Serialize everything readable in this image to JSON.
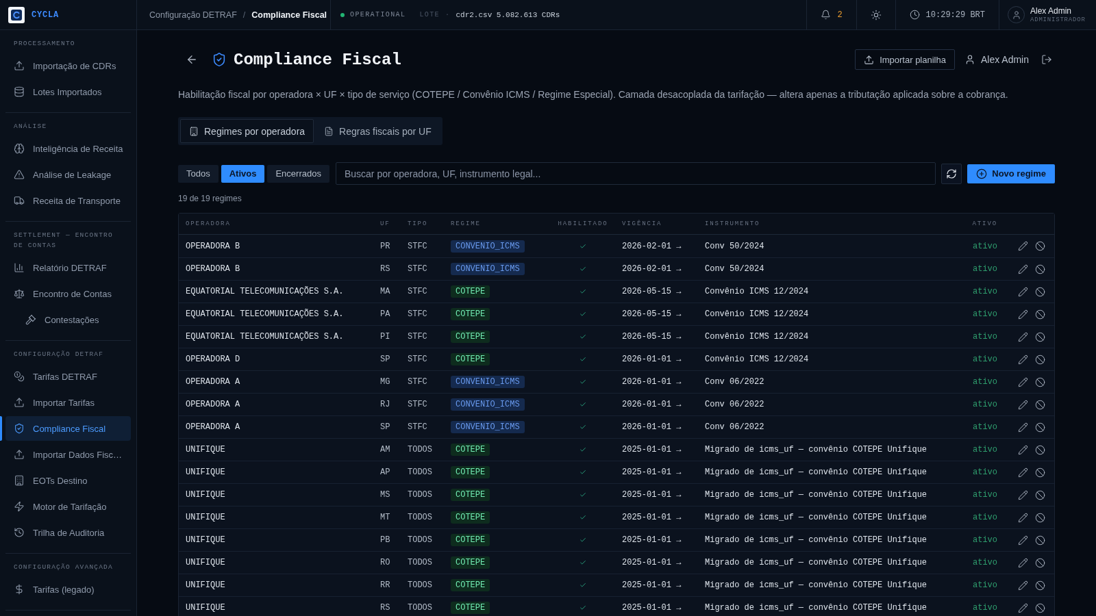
{
  "top_bar": {
    "brand": "CYCLA",
    "breadcrumb": {
      "parent": "Configuração DETRAF",
      "separator": "/",
      "current": "Compliance Fiscal"
    },
    "status": {
      "label": "OPERATIONAL",
      "online": true
    },
    "batch": {
      "label": "LOTE",
      "separator": "·",
      "file": "cdr2.csv 5.082.613 CDRs"
    },
    "notifications": {
      "count": "2"
    },
    "clock": "10:29:29 BRT",
    "user": {
      "name": "Alex Admin",
      "role": "ADMINISTRADOR"
    }
  },
  "sidebar": {
    "sections": [
      {
        "title": "PROCESSAMENTO",
        "items": [
          {
            "label": "Importação de CDRs",
            "selected": false
          },
          {
            "label": "Lotes Importados",
            "selected": false
          }
        ]
      },
      {
        "title": "ANÁLISE",
        "items": [
          {
            "label": "Inteligência de Receita",
            "selected": false
          },
          {
            "label": "Análise de Leakage",
            "selected": false
          },
          {
            "label": "Receita de Transporte",
            "selected": false
          }
        ]
      },
      {
        "title": "SETTLEMENT — ENCONTRO DE CONTAS",
        "items": [
          {
            "label": "Relatório DETRAF",
            "selected": false
          },
          {
            "label": "Encontro de Contas",
            "selected": false,
            "children": [
              {
                "label": "Contestações",
                "selected": false
              }
            ]
          }
        ]
      },
      {
        "title": "CONFIGURAÇÃO DETRAF",
        "items": [
          {
            "label": "Tarifas DETRAF",
            "selected": false
          },
          {
            "label": "Importar Tarifas",
            "selected": false
          },
          {
            "label": "Compliance Fiscal",
            "selected": true
          },
          {
            "label": "Importar Dados Fisc…",
            "selected": false
          },
          {
            "label": "EOTs Destino",
            "selected": false
          },
          {
            "label": "Motor de Tarifação",
            "selected": false
          },
          {
            "label": "Trilha de Auditoria",
            "selected": false
          }
        ]
      },
      {
        "title": "CONFIGURAÇÃO AVANÇADA",
        "items": [
          {
            "label": "Tarifas (legado)",
            "selected": false
          }
        ]
      }
    ]
  },
  "page": {
    "title": "Compliance Fiscal",
    "import_button": "Importar planilha",
    "user_name": "Alex Admin",
    "description": "Habilitação fiscal por operadora × UF × tipo de serviço (COTEPE / Convênio ICMS / Regime Especial). Camada desacoplada da tarifação — altera apenas a tributação aplicada sobre a cobrança.",
    "tabs": [
      {
        "label": "Regimes por operadora",
        "selected": true
      },
      {
        "label": "Regras fiscais por UF",
        "selected": false
      }
    ],
    "filters": [
      {
        "label": "Todos",
        "selected": false
      },
      {
        "label": "Ativos",
        "selected": true
      },
      {
        "label": "Encerrados",
        "selected": false
      }
    ],
    "search": {
      "placeholder": "Buscar por operadora, UF, instrumento legal..."
    },
    "new_button": "Novo regime",
    "count": "19 de 19 regimes",
    "table": {
      "columns": [
        "OPERADORA",
        "UF",
        "TIPO",
        "REGIME",
        "HABILITADO",
        "VIGÊNCIA",
        "INSTRUMENTO",
        "ATIVO"
      ],
      "rows": [
        {
          "operadora": "OPERADORA B",
          "uf": "PR",
          "tipo": "STFC",
          "regime": {
            "label": "CONVENIO_ICMS",
            "color": "#152a4e"
          },
          "enabled": true,
          "vigencia": "2026-02-01 →",
          "instrumento": "Conv 50/2024",
          "status": "ativo"
        },
        {
          "operadora": "OPERADORA B",
          "uf": "RS",
          "tipo": "STFC",
          "regime": {
            "label": "CONVENIO_ICMS",
            "color": "#152a4e"
          },
          "enabled": true,
          "vigencia": "2026-02-01 →",
          "instrumento": "Conv 50/2024",
          "status": "ativo"
        },
        {
          "operadora": "EQUATORIAL TELECOMUNICAÇÕES S.A.",
          "uf": "MA",
          "tipo": "STFC",
          "regime": {
            "label": "COTEPE",
            "color": "#0e2c1e"
          },
          "enabled": true,
          "vigencia": "2026-05-15 →",
          "instrumento": "Convênio ICMS 12/2024",
          "status": "ativo"
        },
        {
          "operadora": "EQUATORIAL TELECOMUNICAÇÕES S.A.",
          "uf": "PA",
          "tipo": "STFC",
          "regime": {
            "label": "COTEPE",
            "color": "#0e2c1e"
          },
          "enabled": true,
          "vigencia": "2026-05-15 →",
          "instrumento": "Convênio ICMS 12/2024",
          "status": "ativo"
        },
        {
          "operadora": "EQUATORIAL TELECOMUNICAÇÕES S.A.",
          "uf": "PI",
          "tipo": "STFC",
          "regime": {
            "label": "COTEPE",
            "color": "#0e2c1e"
          },
          "enabled": true,
          "vigencia": "2026-05-15 →",
          "instrumento": "Convênio ICMS 12/2024",
          "status": "ativo"
        },
        {
          "operadora": "OPERADORA D",
          "uf": "SP",
          "tipo": "STFC",
          "regime": {
            "label": "COTEPE",
            "color": "#0e2c1e"
          },
          "enabled": true,
          "vigencia": "2026-01-01 →",
          "instrumento": "Convênio ICMS 12/2024",
          "status": "ativo"
        },
        {
          "operadora": "OPERADORA A",
          "uf": "MG",
          "tipo": "STFC",
          "regime": {
            "label": "CONVENIO_ICMS",
            "color": "#152a4e"
          },
          "enabled": true,
          "vigencia": "2026-01-01 →",
          "instrumento": "Conv 06/2022",
          "status": "ativo"
        },
        {
          "operadora": "OPERADORA A",
          "uf": "RJ",
          "tipo": "STFC",
          "regime": {
            "label": "CONVENIO_ICMS",
            "color": "#152a4e"
          },
          "enabled": true,
          "vigencia": "2026-01-01 →",
          "instrumento": "Conv 06/2022",
          "status": "ativo"
        },
        {
          "operadora": "OPERADORA A",
          "uf": "SP",
          "tipo": "STFC",
          "regime": {
            "label": "CONVENIO_ICMS",
            "color": "#152a4e"
          },
          "enabled": true,
          "vigencia": "2026-01-01 →",
          "instrumento": "Conv 06/2022",
          "status": "ativo"
        },
        {
          "operadora": "UNIFIQUE",
          "uf": "AM",
          "tipo": "TODOS",
          "regime": {
            "label": "COTEPE",
            "color": "#0e2c1e"
          },
          "enabled": true,
          "vigencia": "2025-01-01 →",
          "instrumento": "Migrado de icms_uf — convênio COTEPE Unifique",
          "status": "ativo"
        },
        {
          "operadora": "UNIFIQUE",
          "uf": "AP",
          "tipo": "TODOS",
          "regime": {
            "label": "COTEPE",
            "color": "#0e2c1e"
          },
          "enabled": true,
          "vigencia": "2025-01-01 →",
          "instrumento": "Migrado de icms_uf — convênio COTEPE Unifique",
          "status": "ativo"
        },
        {
          "operadora": "UNIFIQUE",
          "uf": "MS",
          "tipo": "TODOS",
          "regime": {
            "label": "COTEPE",
            "color": "#0e2c1e"
          },
          "enabled": true,
          "vigencia": "2025-01-01 →",
          "instrumento": "Migrado de icms_uf — convênio COTEPE Unifique",
          "status": "ativo"
        },
        {
          "operadora": "UNIFIQUE",
          "uf": "MT",
          "tipo": "TODOS",
          "regime": {
            "label": "COTEPE",
            "color": "#0e2c1e"
          },
          "enabled": true,
          "vigencia": "2025-01-01 →",
          "instrumento": "Migrado de icms_uf — convênio COTEPE Unifique",
          "status": "ativo"
        },
        {
          "operadora": "UNIFIQUE",
          "uf": "PB",
          "tipo": "TODOS",
          "regime": {
            "label": "COTEPE",
            "color": "#0e2c1e"
          },
          "enabled": true,
          "vigencia": "2025-01-01 →",
          "instrumento": "Migrado de icms_uf — convênio COTEPE Unifique",
          "status": "ativo"
        },
        {
          "operadora": "UNIFIQUE",
          "uf": "RO",
          "tipo": "TODOS",
          "regime": {
            "label": "COTEPE",
            "color": "#0e2c1e"
          },
          "enabled": true,
          "vigencia": "2025-01-01 →",
          "instrumento": "Migrado de icms_uf — convênio COTEPE Unifique",
          "status": "ativo"
        },
        {
          "operadora": "UNIFIQUE",
          "uf": "RR",
          "tipo": "TODOS",
          "regime": {
            "label": "COTEPE",
            "color": "#0e2c1e"
          },
          "enabled": true,
          "vigencia": "2025-01-01 →",
          "instrumento": "Migrado de icms_uf — convênio COTEPE Unifique",
          "status": "ativo"
        },
        {
          "operadora": "UNIFIQUE",
          "uf": "RS",
          "tipo": "TODOS",
          "regime": {
            "label": "COTEPE",
            "color": "#0e2c1e"
          },
          "enabled": true,
          "vigencia": "2025-01-01 →",
          "instrumento": "Migrado de icms_uf — convênio COTEPE Unifique",
          "status": "ativo"
        }
      ]
    }
  }
}
